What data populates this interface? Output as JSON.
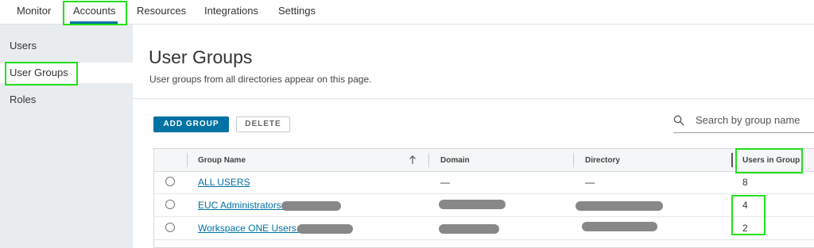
{
  "topnav": {
    "tabs": [
      {
        "label": "Monitor"
      },
      {
        "label": "Accounts"
      },
      {
        "label": "Resources"
      },
      {
        "label": "Integrations"
      },
      {
        "label": "Settings"
      }
    ],
    "active": "Accounts"
  },
  "sidebar": {
    "items": [
      {
        "label": "Users"
      },
      {
        "label": "User Groups"
      },
      {
        "label": "Roles"
      }
    ],
    "active": "User Groups"
  },
  "page": {
    "title": "User Groups",
    "subtitle": "User groups from all directories appear on this page."
  },
  "toolbar": {
    "add_label": "ADD GROUP",
    "delete_label": "DELETE"
  },
  "search": {
    "placeholder": "Search by group name",
    "value": ""
  },
  "grid": {
    "columns": [
      "Group Name",
      "Domain",
      "Directory",
      "Users in Group"
    ],
    "sort_icon": "arrow-up-icon",
    "rows": [
      {
        "name": "ALL USERS",
        "domain": "—",
        "directory": "—",
        "users": "8"
      },
      {
        "name": "EUC Administrators@",
        "domain": "",
        "directory": "",
        "users": "4"
      },
      {
        "name": "Workspace ONE Users@",
        "domain": "",
        "directory": "",
        "users": "2"
      }
    ]
  },
  "colors": {
    "accent": "#0072a3",
    "sidebar_bg": "#e8ecef",
    "highlight": "#22e01b"
  }
}
